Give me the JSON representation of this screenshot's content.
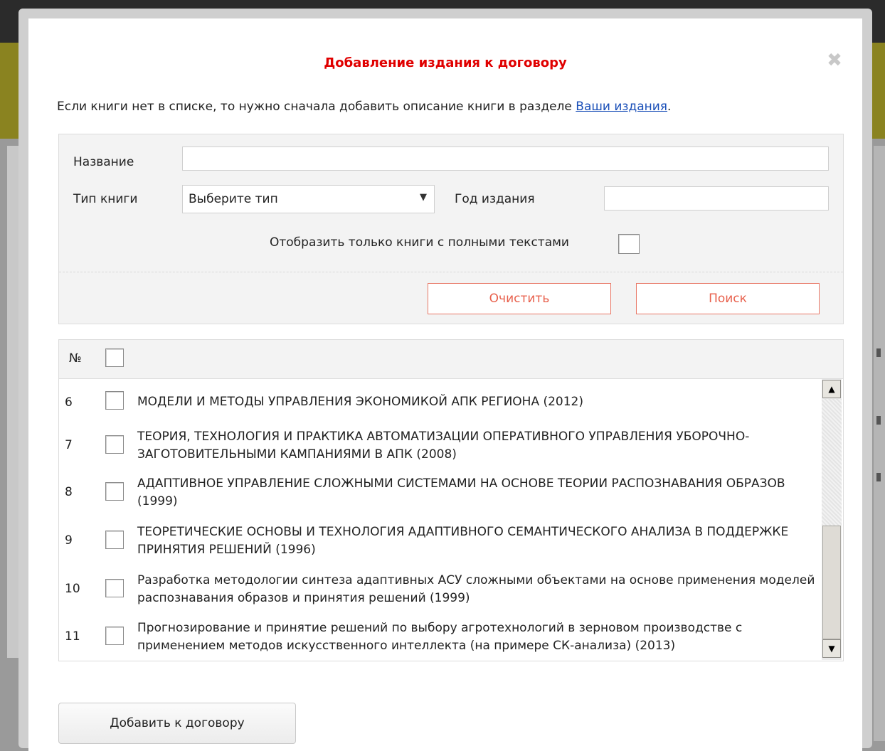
{
  "dialog": {
    "title": "Добавление издания к договору",
    "close_icon": "✖",
    "info_text": "Если книги нет в списке, то нужно сначала добавить описание книги в разделе ",
    "info_link": "Ваши издания",
    "info_tail": "."
  },
  "filter": {
    "name_label": "Название",
    "name_value": "",
    "type_label": "Тип книги",
    "type_selected": "Выберите тип",
    "year_label": "Год издания",
    "year_value": "",
    "fulltext_label": "Отобразить только книги с полными текстами",
    "clear_label": "Очистить",
    "search_label": "Поиск"
  },
  "table": {
    "num_header": "№",
    "rows": [
      {
        "num": "6",
        "text": "МОДЕЛИ И МЕТОДЫ УПРАВЛЕНИЯ ЭКОНОМИКОЙ АПК РЕГИОНА (2012)"
      },
      {
        "num": "7",
        "text": "ТЕОРИЯ, ТЕХНОЛОГИЯ И ПРАКТИКА АВТОМАТИЗАЦИИ ОПЕРАТИВНОГО УПРАВЛЕНИЯ УБОРОЧНО-ЗАГОТОВИТЕЛЬНЫМИ КАМПАНИЯМИ В АПК (2008)"
      },
      {
        "num": "8",
        "text": "АДАПТИВНОЕ УПРАВЛЕНИЕ СЛОЖНЫМИ СИСТЕМАМИ НА ОСНОВЕ ТЕОРИИ РАСПОЗНАВАНИЯ ОБРАЗОВ (1999)"
      },
      {
        "num": "9",
        "text": "ТЕОРЕТИЧЕСКИЕ ОСНОВЫ И ТЕХНОЛОГИЯ АДАПТИВНОГО СЕМАНТИЧЕСКОГО АНАЛИЗА В ПОДДЕРЖКЕ ПРИНЯТИЯ РЕШЕНИЙ (1996)"
      },
      {
        "num": "10",
        "text": "Разработка методологии синтеза адаптивных АСУ сложными объектами на основе применения моделей распознавания образов и принятия решений (1999)"
      },
      {
        "num": "11",
        "text": "Прогнозирование и принятие решений по выбору агротехнологий в зерновом производстве с применением методов искусственного интеллекта (на примере СК-анализа) (2013)"
      }
    ]
  },
  "scrollbar": {
    "up_icon": "▲",
    "down_icon": "▼"
  },
  "add_button_label": "Добавить к договору"
}
